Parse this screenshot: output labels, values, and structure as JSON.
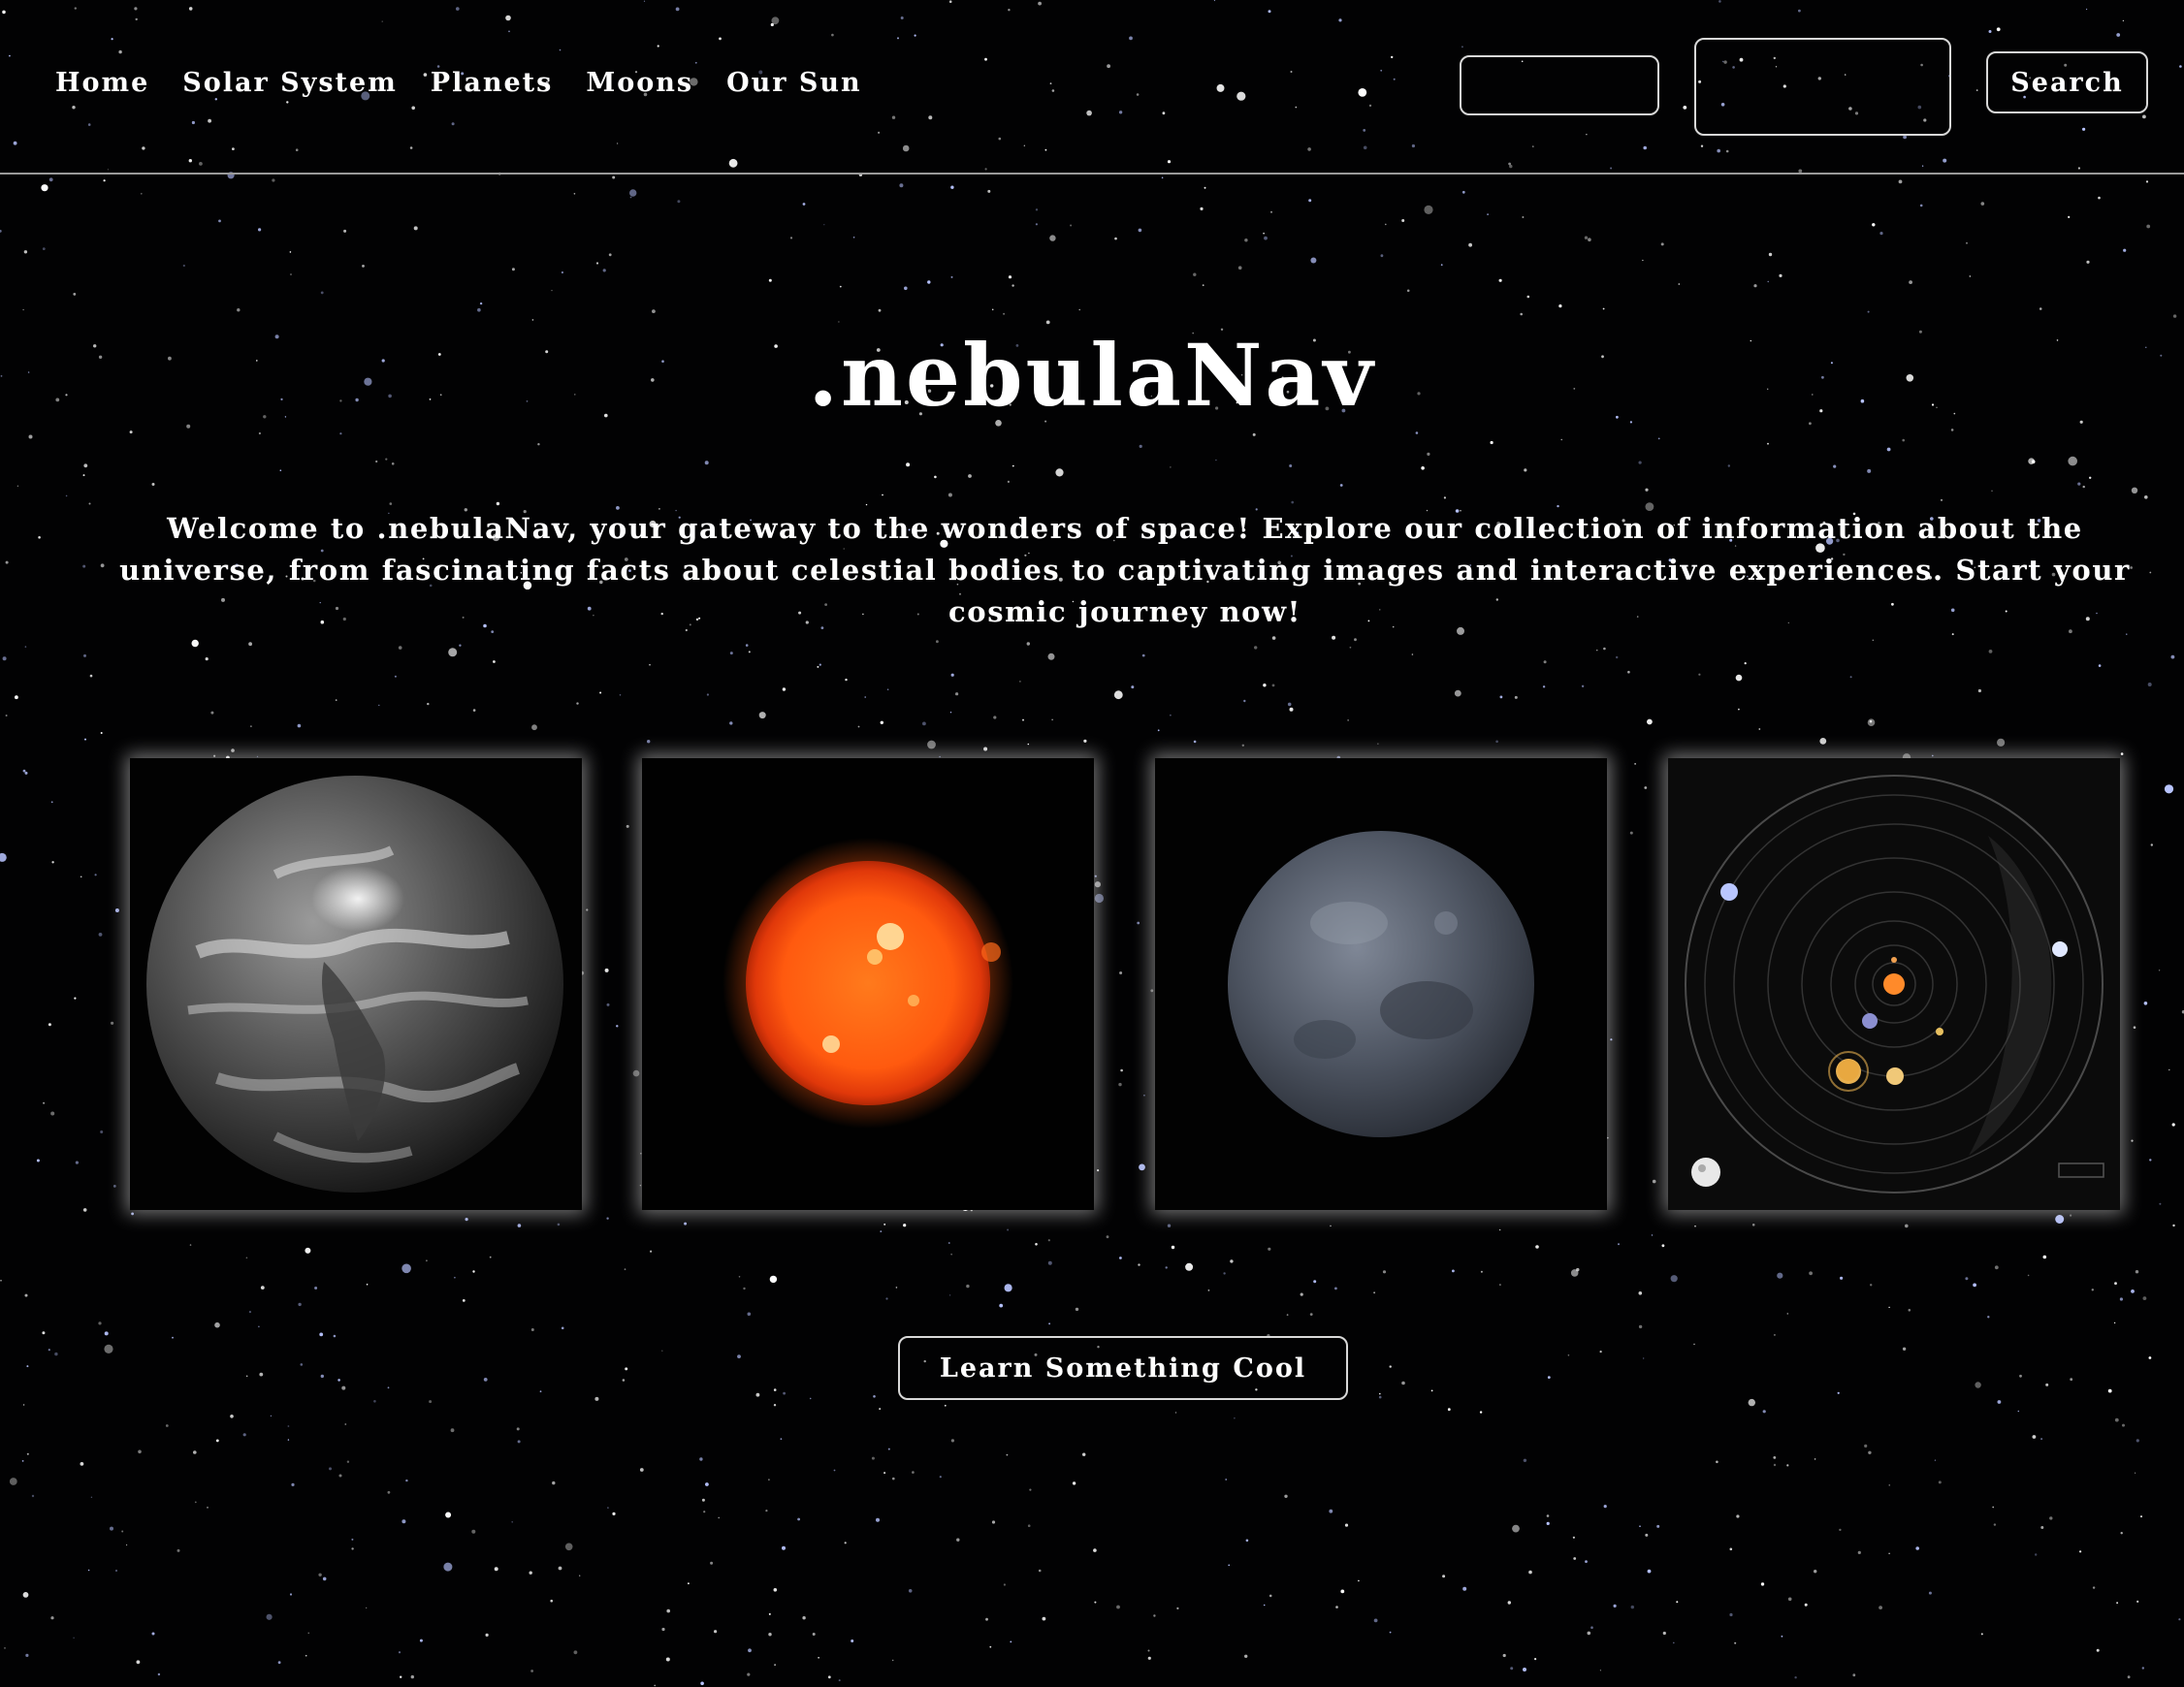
{
  "nav": {
    "links": [
      {
        "label": "Home"
      },
      {
        "label": "Solar System"
      },
      {
        "label": "Planets"
      },
      {
        "label": "Moons"
      },
      {
        "label": "Our Sun"
      }
    ],
    "search_label": "Search"
  },
  "hero": {
    "title": ".nebulaNav",
    "intro": "Welcome to .nebulaNav, your gateway to the wonders of space! Explore our collection of information about the universe, from fascinating facts about celestial bodies to captivating images and interactive experiences. Start your cosmic journey now!"
  },
  "gallery": {
    "images": [
      {
        "subject": "earth"
      },
      {
        "subject": "sun"
      },
      {
        "subject": "moon"
      },
      {
        "subject": "solar-system-orbits"
      }
    ]
  },
  "cta": {
    "label": "Learn Something Cool"
  },
  "colors": {
    "background": "#020203",
    "text": "#ffffff",
    "border": "#d8d8d8",
    "sun": "#ff5a0f"
  }
}
